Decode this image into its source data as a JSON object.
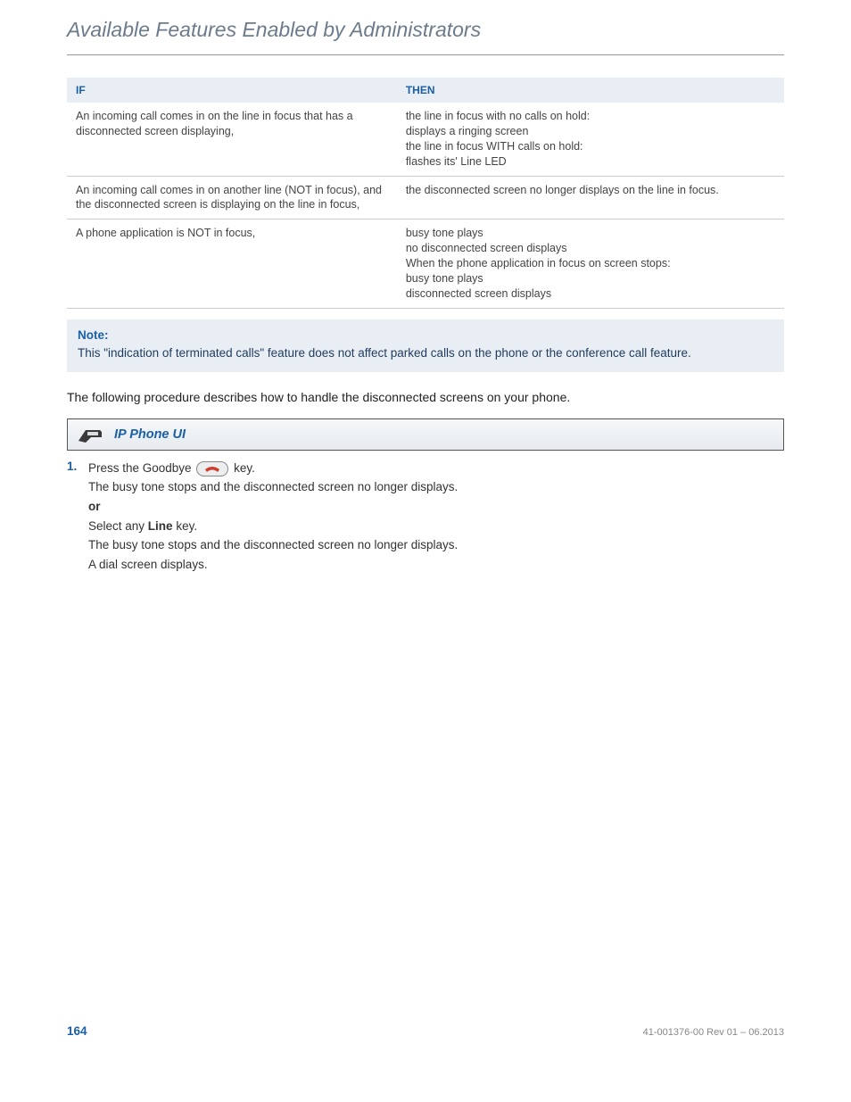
{
  "title": "Available Features Enabled by Administrators",
  "table": {
    "headers": [
      "IF",
      "THEN"
    ],
    "rows": [
      {
        "if": "An incoming call comes in on the line in focus that has a disconnected screen displaying,",
        "then": [
          "the line in focus with no calls on hold:",
          "displays a ringing screen",
          "the line in focus WITH calls on hold:",
          "flashes its' Line LED"
        ]
      },
      {
        "if": "An incoming call comes in on another line (NOT in focus), and the disconnected screen is displaying on the line in focus,",
        "then": [
          "the disconnected screen no longer displays on the line in focus."
        ]
      },
      {
        "if": "A phone application is NOT in focus,",
        "then": [
          "busy tone plays",
          "no disconnected screen displays",
          "When the phone application in focus on screen stops:",
          "busy tone plays",
          "disconnected screen displays"
        ]
      }
    ]
  },
  "note": {
    "title": "Note:",
    "body": "This \"indication of terminated calls\" feature does not affect parked calls on the phone or the conference call feature."
  },
  "intro": "The following procedure describes how to handle the disconnected screens on your phone.",
  "ui_bar_label": "IP Phone UI",
  "step": {
    "num": "1.",
    "press_prefix": "Press the Goodbye ",
    "press_suffix": " key.",
    "line1": "The busy tone stops and the disconnected screen no longer displays.",
    "or": "or",
    "select_prefix": "Select any ",
    "select_bold": "Line",
    "select_suffix": " key.",
    "line2": "The busy tone stops and the disconnected screen no longer displays.",
    "line3": "A dial screen displays."
  },
  "footer": {
    "page": "164",
    "docid": "41-001376-00 Rev 01 – 06.2013"
  }
}
